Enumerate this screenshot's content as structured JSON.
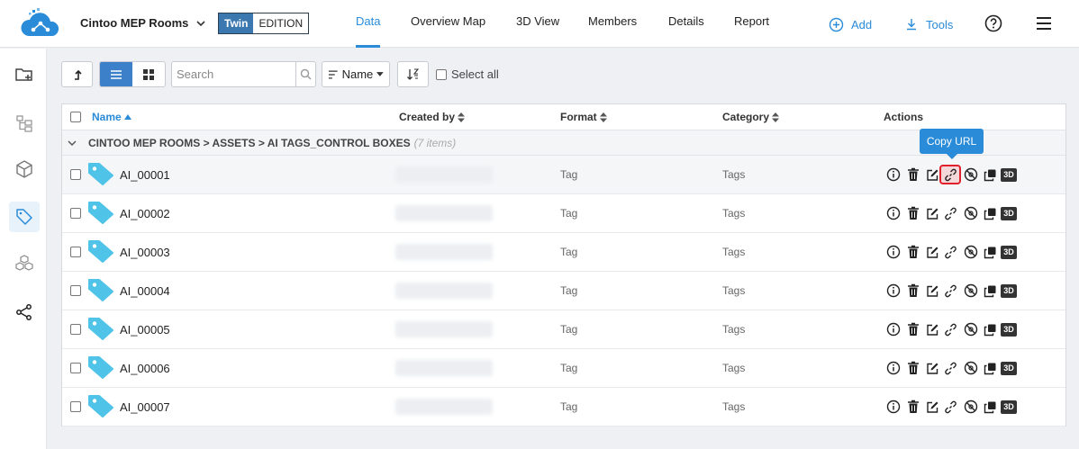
{
  "header": {
    "project_name": "Cintoo MEP Rooms",
    "edition_twin": "Twin",
    "edition_label": "EDITION",
    "tabs": [
      {
        "label": "Data",
        "active": true
      },
      {
        "label": "Overview Map",
        "active": false
      },
      {
        "label": "3D View",
        "active": false
      },
      {
        "label": "Members",
        "active": false
      },
      {
        "label": "Details",
        "active": false
      },
      {
        "label": "Report",
        "active": false
      }
    ],
    "add_label": "Add",
    "tools_label": "Tools"
  },
  "sidebar": {
    "items": [
      {
        "icon": "folder-icon",
        "active": false
      },
      {
        "icon": "hierarchy-icon",
        "active": false
      },
      {
        "icon": "cube-icon",
        "active": false
      },
      {
        "icon": "tag-icon",
        "active": true
      },
      {
        "icon": "cubes-icon",
        "active": false
      },
      {
        "icon": "share-icon",
        "active": false
      }
    ]
  },
  "toolbar": {
    "search_placeholder": "Search",
    "sort_label": "Name",
    "select_all_label": "Select all"
  },
  "table": {
    "columns": {
      "name": "Name",
      "created_by": "Created by",
      "format": "Format",
      "category": "Category",
      "actions": "Actions"
    },
    "group": {
      "path": "CINTOO MEP ROOMS > ASSETS > AI TAGS_CONTROL BOXES",
      "count": "(7 items)"
    },
    "rows": [
      {
        "name": "AI_00001",
        "format": "Tag",
        "category": "Tags"
      },
      {
        "name": "AI_00002",
        "format": "Tag",
        "category": "Tags"
      },
      {
        "name": "AI_00003",
        "format": "Tag",
        "category": "Tags"
      },
      {
        "name": "AI_00004",
        "format": "Tag",
        "category": "Tags"
      },
      {
        "name": "AI_00005",
        "format": "Tag",
        "category": "Tags"
      },
      {
        "name": "AI_00006",
        "format": "Tag",
        "category": "Tags"
      },
      {
        "name": "AI_00007",
        "format": "Tag",
        "category": "Tags"
      }
    ],
    "action_3d_label": "3D"
  },
  "tooltip": {
    "text": "Copy URL"
  },
  "colors": {
    "accent": "#2a8bd8",
    "tag_icon": "#4fc3e8",
    "highlight": "#e0202a"
  }
}
